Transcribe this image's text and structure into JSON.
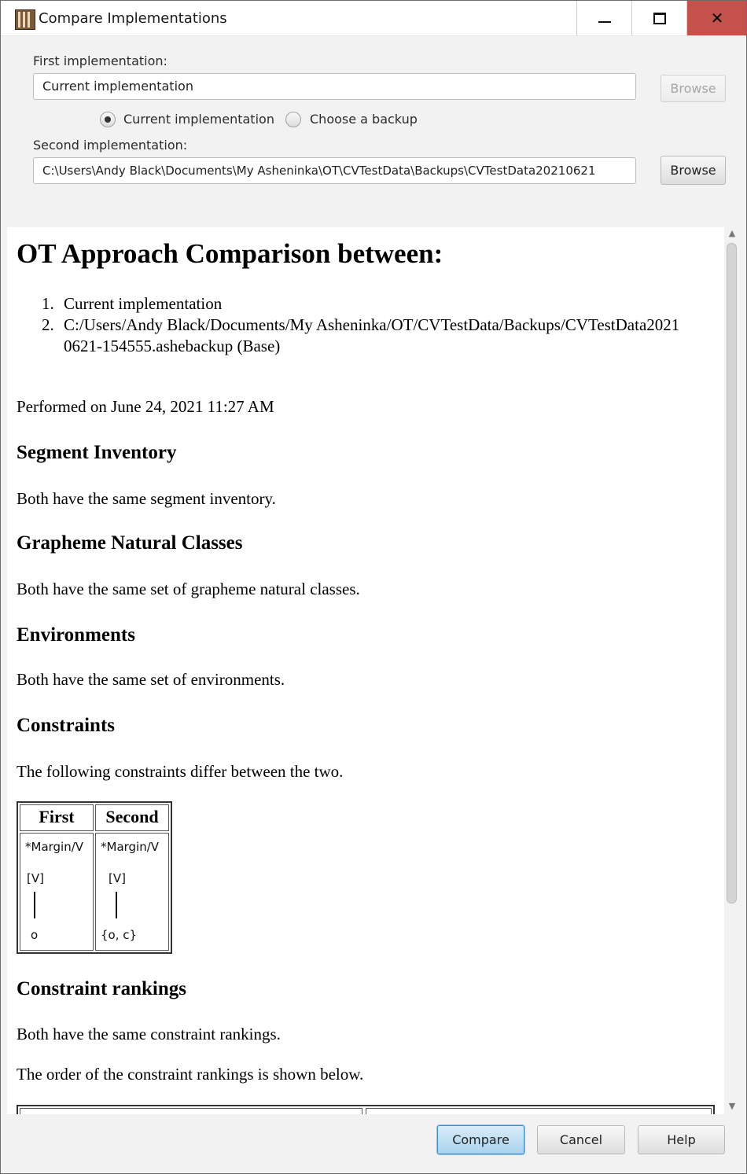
{
  "window": {
    "title": "Compare Implementations",
    "icon": "bookshelf-icon",
    "controls": {
      "minimize": "minimize-icon",
      "maximize": "maximize-icon",
      "close": "close-icon"
    }
  },
  "first": {
    "label": "First implementation:",
    "value": "Current implementation",
    "browse_label": "Browse",
    "radio_current": "Current implementation",
    "radio_backup": "Choose a backup",
    "selected": "current"
  },
  "second": {
    "label": "Second implementation:",
    "value": "C:\\Users\\Andy Black\\Documents\\My Asheninka\\OT\\CVTestData\\Backups\\CVTestData20210621",
    "browse_label": "Browse"
  },
  "report": {
    "title": "OT Approach Comparison between:",
    "items": [
      {
        "num": "1.",
        "text": "Current implementation"
      },
      {
        "num": "2.",
        "text": "C:/Users/Andy Black/Documents/My Asheninka/OT/CVTestData/Backups/CVTestData20210621-154555.ashebackup (Base)"
      }
    ],
    "performed": "Performed on June 24, 2021 11:27 AM",
    "sections": [
      {
        "heading": "Segment Inventory",
        "text": "Both have the same segment inventory."
      },
      {
        "heading": "Grapheme Natural Classes",
        "text": "Both have the same set of grapheme natural classes."
      },
      {
        "heading": "Environments",
        "text": "Both have the same set of environments."
      },
      {
        "heading": "Constraints",
        "text": "The following constraints differ between the two."
      }
    ],
    "constraints_table": {
      "headers": [
        "First",
        "Second"
      ],
      "rows": [
        {
          "first": {
            "name": "*Margin/V",
            "top": "[V]",
            "bottom": "o"
          },
          "second": {
            "name": "*Margin/V",
            "top": "[V]",
            "bottom": "{o, c}"
          }
        }
      ]
    },
    "rankings": {
      "heading": "Constraint rankings",
      "text1": "Both have the same constraint rankings.",
      "text2": "The order of the constraint rankings is shown below."
    }
  },
  "buttons": {
    "compare": "Compare",
    "cancel": "Cancel",
    "help": "Help"
  }
}
